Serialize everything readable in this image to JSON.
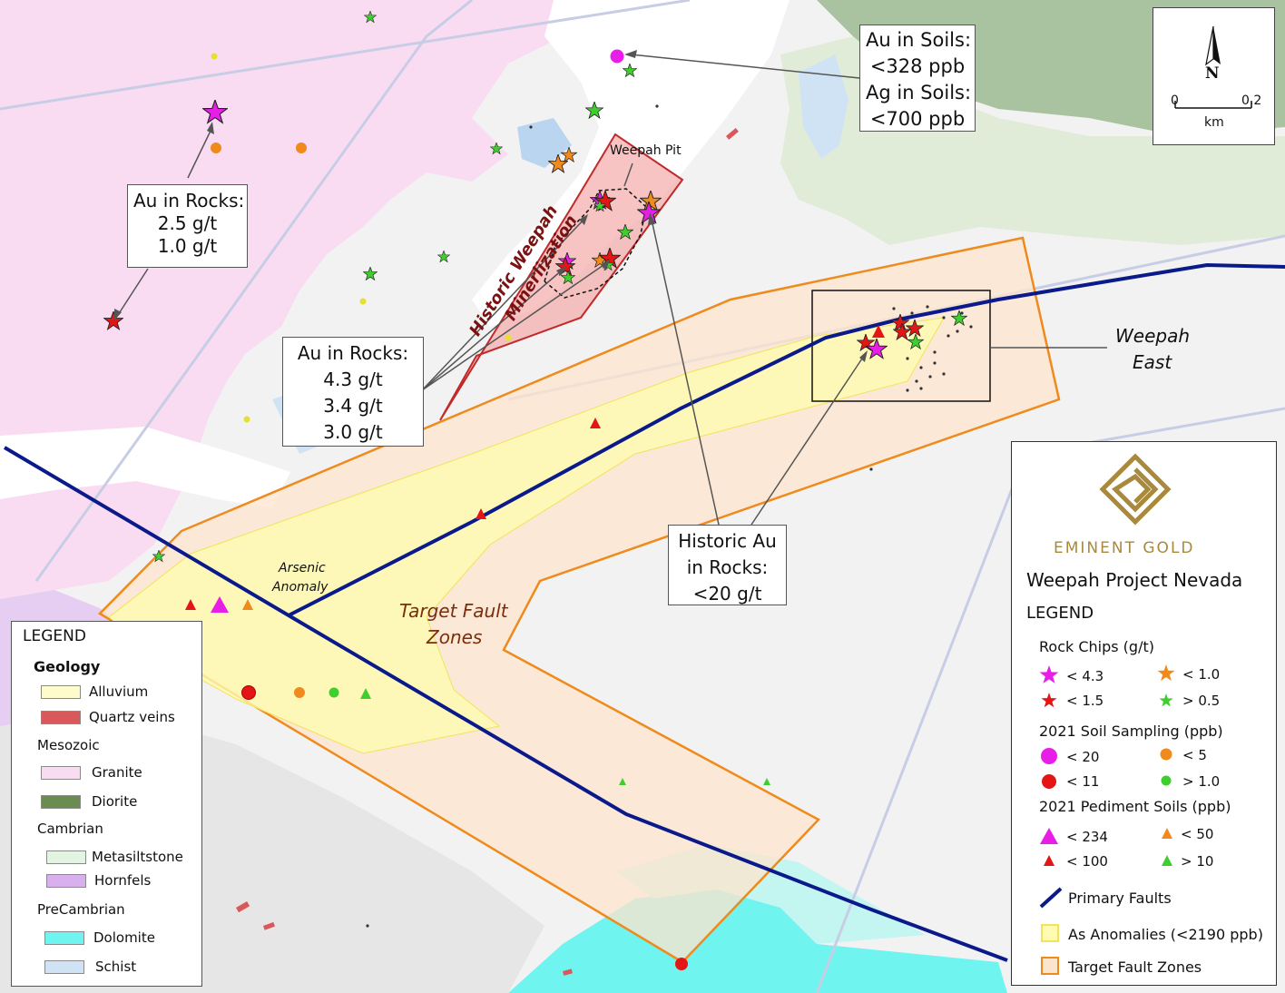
{
  "colors": {
    "granite": "#fadcf2",
    "diorite": "#6a8c4e",
    "quartz": "#d9595b",
    "alluvium": "#fffccc",
    "metasiltstone": "#e4f4e2",
    "hornfels": "#d8b0ee",
    "dolomite": "#6ff4f0",
    "schist": "#cfe3f5",
    "fault": "#0b1a8a",
    "target_zone_fill": "#fde4cc",
    "target_zone_edge": "#ef8a1d",
    "anomaly_fill": "#fffbb0",
    "anomaly_edge": "#f2e35a",
    "magenta": "#e81ee8",
    "red": "#e41515",
    "orange": "#f08a1c",
    "green": "#3ecf2e",
    "brand_gold": "#a98a3c"
  },
  "callouts": {
    "au_rocks_west": [
      "Au in Rocks:",
      "2.5 g/t",
      "1.0 g/t"
    ],
    "au_rocks_center": [
      "Au in Rocks:",
      "4.3 g/t",
      "3.4 g/t",
      "3.0 g/t"
    ],
    "historic_au": [
      "Historic Au",
      "in Rocks:",
      "<20 g/t"
    ],
    "au_in_soils_title": "Au in Soils:",
    "au_in_soils_value": "<328 ppb",
    "ag_in_soils_title": "Ag in Soils:",
    "ag_in_soils_value": "<700 ppb"
  },
  "map_labels": {
    "weepah_pit": "Weepah Pit",
    "historic_weepah_1": "Historic Weepah",
    "historic_weepah_2": "Minerlization",
    "weepah_east_1": "Weepah",
    "weepah_east_2": "East",
    "arsenic_1": "Arsenic",
    "arsenic_2": "Anomaly",
    "target_fault_1": "Target  Fault",
    "target_fault_2": "Zones"
  },
  "scale_bar": {
    "north": "N",
    "start": "0",
    "end": "0.2",
    "unit": "km"
  },
  "legend_left": {
    "title": "LEGEND",
    "sections": [
      {
        "heading": "Geology",
        "items": [
          {
            "label": "Alluvium",
            "color": "#fffccc"
          },
          {
            "label": "Quartz veins",
            "color": "#d9595b"
          }
        ]
      },
      {
        "heading": "Mesozoic",
        "items": [
          {
            "label": "Granite",
            "color": "#fadcf2"
          },
          {
            "label": "Diorite",
            "color": "#6a8c4e"
          }
        ]
      },
      {
        "heading": "Cambrian",
        "items": [
          {
            "label": "Metasiltstone",
            "color": "#e4f4e2"
          },
          {
            "label": "Hornfels",
            "color": "#d8b0ee"
          }
        ]
      },
      {
        "heading": "PreCambrian",
        "items": [
          {
            "label": "Dolomite",
            "color": "#6ff4f0"
          },
          {
            "label": "Schist",
            "color": "#cfe3f5"
          }
        ]
      }
    ]
  },
  "legend_right": {
    "brand": "EMINENT GOLD",
    "project": "Weepah Project Nevada",
    "title": "LEGEND",
    "rock_chips": {
      "heading": "Rock Chips (g/t)",
      "items": [
        "< 4.3",
        "< 1.0",
        "< 1.5",
        "> 0.5"
      ]
    },
    "soil_sampling": {
      "heading": "2021 Soil Sampling (ppb)",
      "items": [
        "< 20",
        "< 5",
        "< 11",
        "> 1.0"
      ]
    },
    "pediment_soils": {
      "heading": "2021 Pediment Soils (ppb)",
      "items": [
        "< 234",
        "< 50",
        "< 100",
        "> 10"
      ]
    },
    "primary_faults": "Primary Faults",
    "as_anomalies": "As Anomalies (<2190 ppb)",
    "target_fault_zones": "Target Fault Zones"
  }
}
